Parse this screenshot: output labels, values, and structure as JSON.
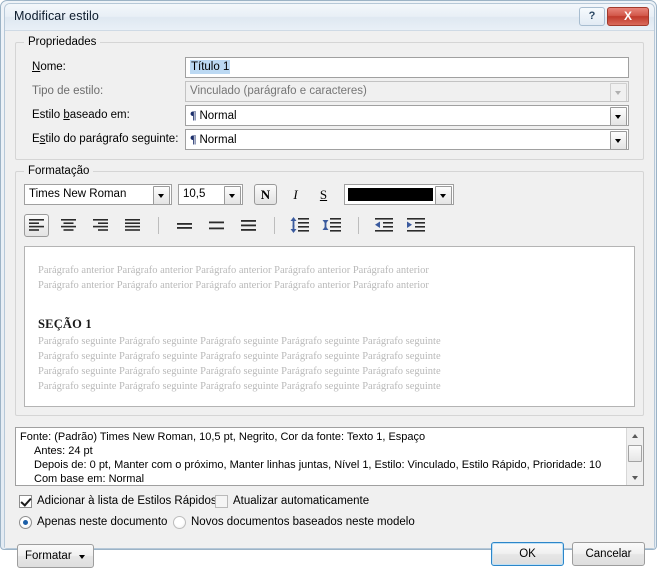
{
  "window": {
    "title": "Modificar estilo",
    "help_label": "?",
    "close_label": "X"
  },
  "properties": {
    "group_label": "Propriedades",
    "name": {
      "label": "Nome:",
      "value": "Título 1"
    },
    "style_type": {
      "label": "Tipo de estilo:",
      "value": "Vinculado (parágrafo e caracteres)"
    },
    "based_on": {
      "label": "Estilo baseado em:",
      "value": "Normal",
      "glyph": "¶"
    },
    "next_style": {
      "label": "Estilo do parágrafo seguinte:",
      "value": "Normal",
      "glyph": "¶"
    }
  },
  "formatting": {
    "group_label": "Formatação",
    "font_family": "Times New Roman",
    "font_size": "10,5",
    "bold_label": "N",
    "italic_label": "I",
    "underline_label": "S",
    "font_color": "#000000"
  },
  "preview": {
    "previous_line": "Parágrafo anterior Parágrafo anterior Parágrafo anterior Parágrafo anterior Parágrafo anterior",
    "heading": "SEÇÃO 1",
    "following_line": "Parágrafo seguinte Parágrafo seguinte Parágrafo seguinte Parágrafo seguinte Parágrafo seguinte"
  },
  "description": {
    "line1": "Fonte: (Padrão) Times New Roman, 10,5 pt, Negrito, Cor da fonte: Texto 1, Espaço",
    "line2": "Antes:  24 pt",
    "line3": "Depois de:  0 pt, Manter com o próximo, Manter linhas juntas, Nível 1, Estilo: Vinculado, Estilo Rápido, Prioridade: 10",
    "line4": "Com base em: Normal"
  },
  "options": {
    "add_to_quick_styles": {
      "label": "Adicionar à lista de Estilos Rápidos",
      "checked": true
    },
    "auto_update": {
      "label": "Atualizar automaticamente",
      "checked": false
    },
    "only_this_document": {
      "label": "Apenas neste documento",
      "selected": true
    },
    "new_documents_template": {
      "label": "Novos documentos baseados neste modelo",
      "selected": false
    }
  },
  "buttons": {
    "format": "Formatar",
    "ok": "OK",
    "cancel": "Cancelar"
  }
}
